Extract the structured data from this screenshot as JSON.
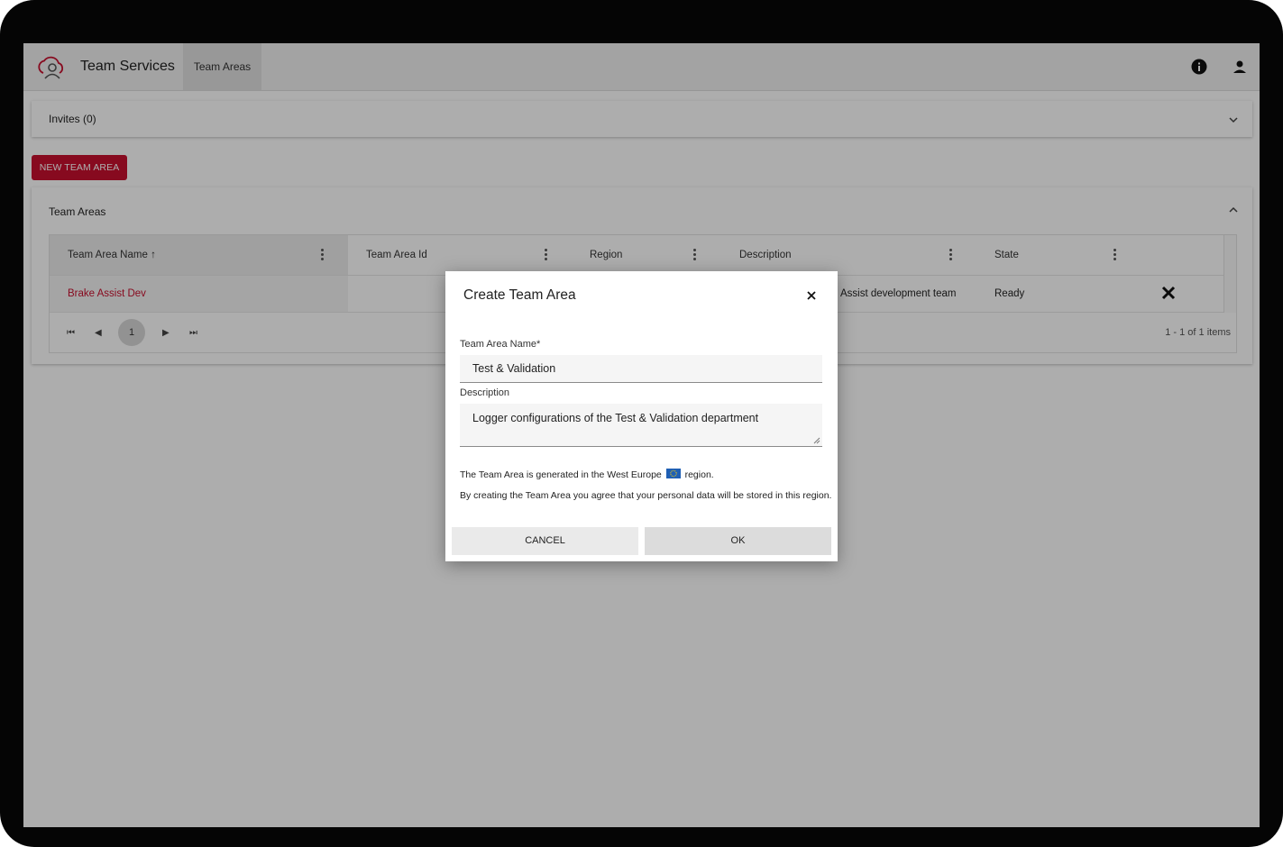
{
  "app": {
    "title": "Team Services",
    "nav_tab": "Team Areas"
  },
  "header_icons": [
    "info-icon",
    "user-icon"
  ],
  "invites": {
    "label": "Invites (0)"
  },
  "new_button": "NEW TEAM AREA",
  "team_areas_panel": {
    "title": "Team Areas",
    "columns": [
      "Team Area Name",
      "Team Area Id",
      "Region",
      "Description",
      "State"
    ],
    "sort_indicator": "↑",
    "rows": [
      {
        "name": "Brake Assist Dev",
        "id": "",
        "region": "",
        "description": "Assist development team",
        "state": "Ready"
      }
    ],
    "pager": {
      "current_page": "1",
      "info": "1 - 1 of 1 items"
    }
  },
  "dialog": {
    "title": "Create Team Area",
    "name_label": "Team Area Name*",
    "name_value": "Test & Validation",
    "description_label": "Description",
    "description_value": "Logger configurations of the Test & Validation department",
    "info_region_prefix": "The Team Area is generated in the West Europe",
    "info_region_suffix": "region.",
    "info_consent": "By creating the Team Area you agree that your personal data will be stored in this region.",
    "cancel_label": "CANCEL",
    "ok_label": "OK"
  },
  "colors": {
    "accent": "#c8102e",
    "header_bg": "#f0f0f0",
    "overlay": "rgba(0,0,0,0.32)"
  }
}
